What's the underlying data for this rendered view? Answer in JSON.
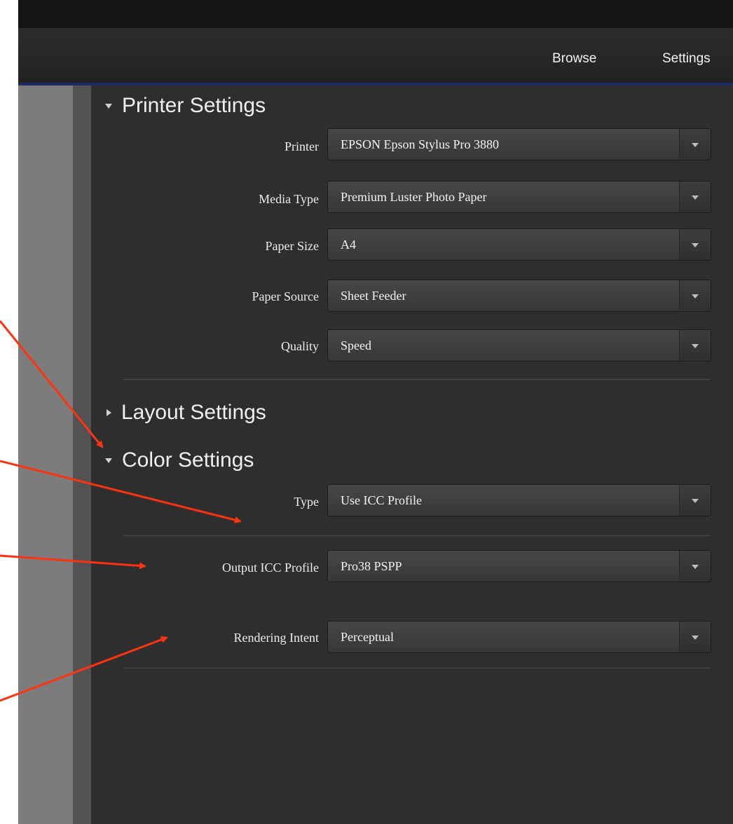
{
  "nav": {
    "browse_label": "Browse",
    "settings_label": "Settings"
  },
  "sections": {
    "printer": {
      "title": "Printer Settings",
      "rows": [
        {
          "label": "Printer",
          "value": "EPSON Epson Stylus Pro 3880"
        },
        {
          "label": "Media Type",
          "value": "Premium Luster Photo Paper"
        },
        {
          "label": "Paper Size",
          "value": "A4"
        },
        {
          "label": "Paper Source",
          "value": "Sheet Feeder"
        },
        {
          "label": "Quality",
          "value": "Speed"
        }
      ]
    },
    "layout": {
      "title": "Layout Settings"
    },
    "color": {
      "title": "Color Settings",
      "rows": [
        {
          "label": "Type",
          "value": "Use ICC Profile"
        },
        {
          "label": "Output ICC Profile",
          "value": "Pro38 PSPP"
        },
        {
          "label": "Rendering Intent",
          "value": "Perceptual"
        }
      ]
    }
  },
  "colors": {
    "annotation_arrow": "#ff3311",
    "panel_bg": "#2e2e2e",
    "nav_accent": "#1a2a6a"
  }
}
